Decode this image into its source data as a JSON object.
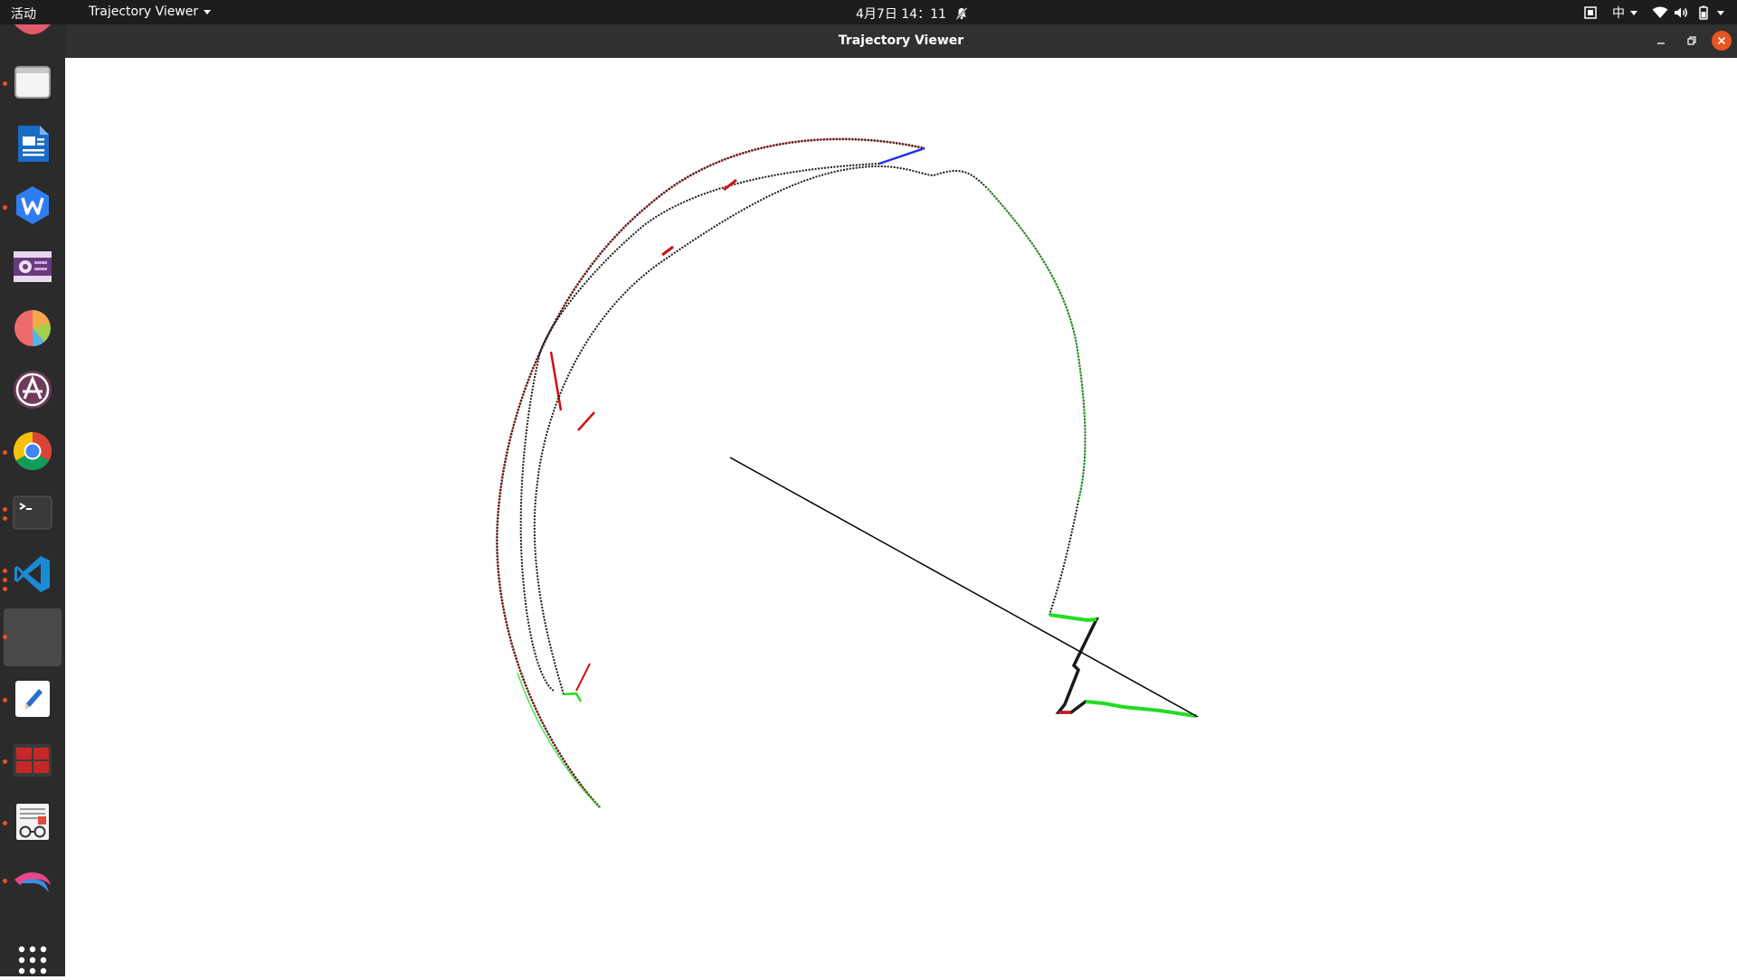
{
  "topbar": {
    "activities_label": "活动",
    "app_menu_label": "Trajectory Viewer",
    "clock": "4月7日  14：11",
    "input_method": "中"
  },
  "dock": {
    "items": [
      {
        "name": "files",
        "running": true
      },
      {
        "name": "libreoffice-writer",
        "running": false
      },
      {
        "name": "wps-office",
        "running": true
      },
      {
        "name": "video-player",
        "running": false
      },
      {
        "name": "pie-chart-app",
        "running": false
      },
      {
        "name": "app-store",
        "running": false
      },
      {
        "name": "chrome",
        "running": true
      },
      {
        "name": "terminal",
        "running": true
      },
      {
        "name": "vscode",
        "running": true
      },
      {
        "name": "trajectory-viewer",
        "running": true
      },
      {
        "name": "text-editor",
        "running": true
      },
      {
        "name": "red-terminal-app",
        "running": true
      },
      {
        "name": "document-viewer",
        "running": true
      },
      {
        "name": "kali-dragon",
        "running": true
      }
    ],
    "show_apps_icon": "grid-icon"
  },
  "window": {
    "title": "Trajectory Viewer"
  },
  "colors": {
    "accent": "#e95420",
    "trajectory_red": "#d01010",
    "trajectory_green": "#22dd22",
    "trajectory_blue": "#2233ee",
    "line_black": "#000000"
  }
}
